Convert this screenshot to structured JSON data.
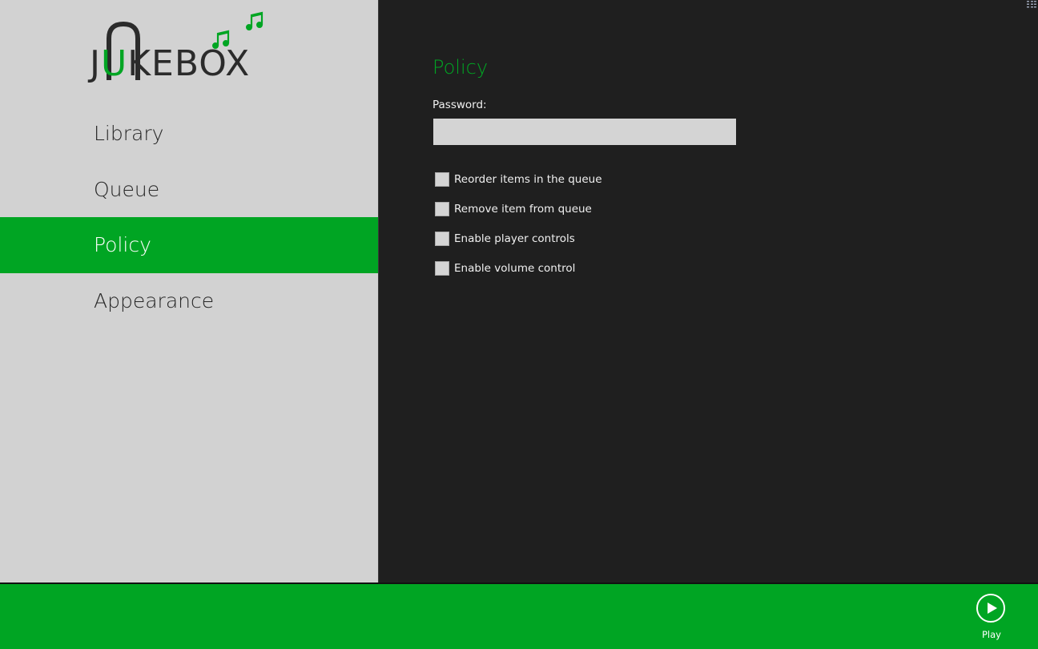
{
  "app": {
    "logo_text_parts": [
      "J",
      "U",
      "KEBOX"
    ],
    "colors": {
      "accent": "#00a523",
      "sidebar_bg": "#d2d2d2",
      "main_bg": "#1f1f1f",
      "text_dark": "#262626",
      "text_light": "#f0f0f0"
    }
  },
  "sidebar": {
    "items": [
      {
        "label": "Library",
        "active": false
      },
      {
        "label": "Queue",
        "active": false
      },
      {
        "label": "Policy",
        "active": true
      },
      {
        "label": "Appearance",
        "active": false
      }
    ]
  },
  "main": {
    "title": "Policy",
    "password": {
      "label": "Password:",
      "value": "",
      "placeholder": ""
    },
    "options": [
      {
        "label": "Reorder items in the queue",
        "checked": false
      },
      {
        "label": "Remove item from queue",
        "checked": false
      },
      {
        "label": "Enable player controls",
        "checked": false
      },
      {
        "label": "Enable volume control",
        "checked": false
      }
    ]
  },
  "appbar": {
    "play": {
      "label": "Play",
      "icon": "play-icon"
    }
  }
}
